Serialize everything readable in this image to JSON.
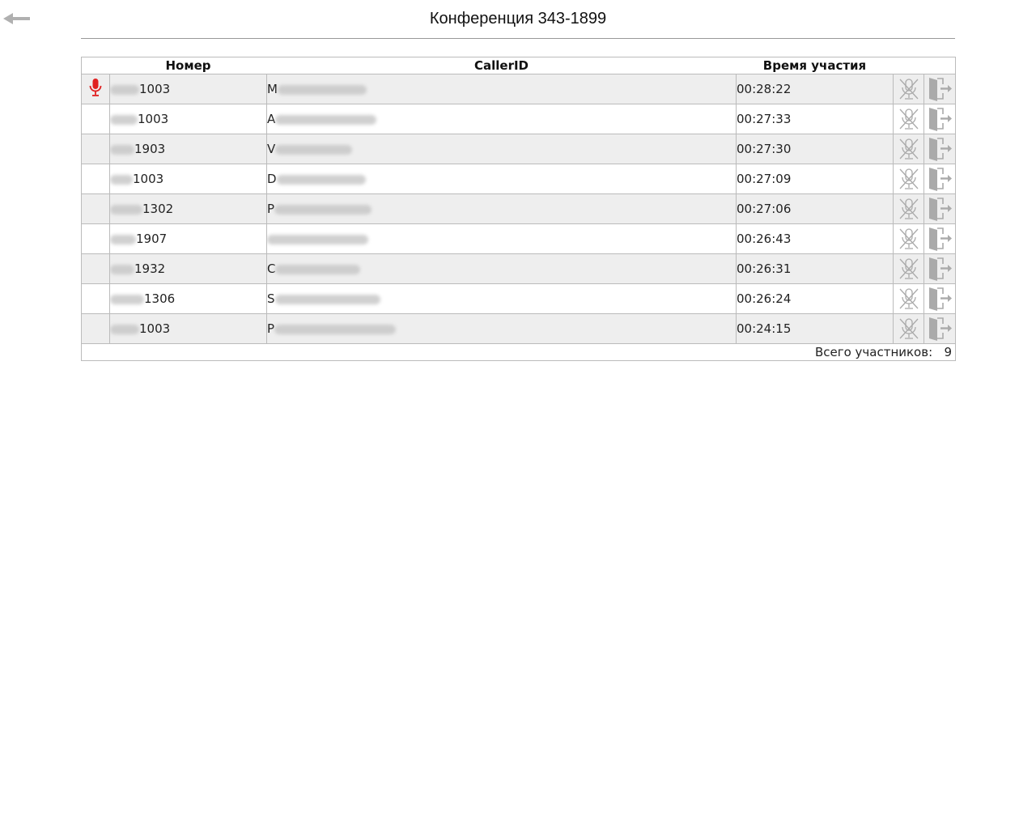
{
  "page": {
    "title": "Конференция 343-1899"
  },
  "table": {
    "headers": {
      "number": "Номер",
      "callerid": "CallerID",
      "time": "Время участия"
    },
    "rows": [
      {
        "speaking": true,
        "number": "1003",
        "callerid": "M",
        "time": "00:28:22"
      },
      {
        "speaking": false,
        "number": "1003",
        "callerid": "A",
        "time": "00:27:33"
      },
      {
        "speaking": false,
        "number": "1903",
        "callerid": "V",
        "time": "00:27:30"
      },
      {
        "speaking": false,
        "number": "1003",
        "callerid": "D",
        "time": "00:27:09"
      },
      {
        "speaking": false,
        "number": "1302",
        "callerid": "P",
        "time": "00:27:06"
      },
      {
        "speaking": false,
        "number": "1907",
        "callerid": "",
        "time": "00:26:43"
      },
      {
        "speaking": false,
        "number": "1932",
        "callerid": "C",
        "time": "00:26:31"
      },
      {
        "speaking": false,
        "number": "1306",
        "callerid": "S",
        "time": "00:26:24"
      },
      {
        "speaking": false,
        "number": "1003",
        "callerid": "P",
        "time": "00:24:15"
      }
    ],
    "footer": {
      "label": "Всего участников:",
      "count": "9"
    }
  },
  "icons": {
    "back": "back-arrow-icon",
    "speaking": "microphone-icon",
    "mute": "microphone-muted-icon",
    "kick": "exit-door-icon"
  },
  "colors": {
    "speaking": "#e02020",
    "action_icon": "#aaaaaa"
  }
}
